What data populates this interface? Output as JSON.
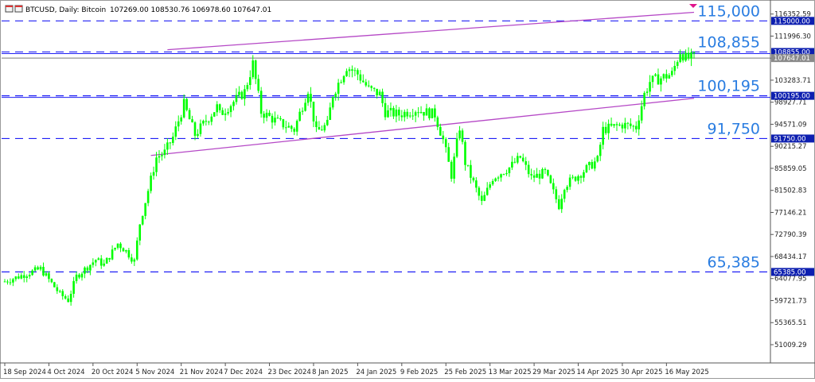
{
  "header": {
    "symbol": "BTCUSD, Daily:  Bitcoin",
    "ohlc": "107269.00  108530.76  106978.60  107647.01"
  },
  "chart_data": {
    "type": "candlestick",
    "symbol": "BTCUSD",
    "timeframe": "Daily",
    "ylim": [
      47400,
      118500
    ],
    "x_range": [
      "2024-09-18",
      "2025-05-26"
    ],
    "y_ticks": [
      "116352.59",
      "111996.30",
      "107640.01",
      "103283.71",
      "98927.71",
      "94571.09",
      "90215.27",
      "85859.05",
      "81502.83",
      "77146.21",
      "72790.39",
      "68434.17",
      "64077.95",
      "59721.73",
      "55365.51",
      "51009.29"
    ],
    "x_ticks": [
      {
        "date": "2024-09-18",
        "label": "18 Sep 2024"
      },
      {
        "date": "2024-10-04",
        "label": "4 Oct 2024"
      },
      {
        "date": "2024-10-20",
        "label": "20 Oct 2024"
      },
      {
        "date": "2024-11-05",
        "label": "5 Nov 2024"
      },
      {
        "date": "2024-11-21",
        "label": "21 Nov 2024"
      },
      {
        "date": "2024-12-07",
        "label": "7 Dec 2024"
      },
      {
        "date": "2024-12-23",
        "label": "23 Dec 2024"
      },
      {
        "date": "2025-01-08",
        "label": "8 Jan 2025"
      },
      {
        "date": "2025-01-24",
        "label": "24 Jan 2025"
      },
      {
        "date": "2025-02-09",
        "label": "9 Feb 2025"
      },
      {
        "date": "2025-02-25",
        "label": "25 Feb 2025"
      },
      {
        "date": "2025-03-13",
        "label": "13 Mar 2025"
      },
      {
        "date": "2025-03-29",
        "label": "29 Mar 2025"
      },
      {
        "date": "2025-04-14",
        "label": "14 Apr 2025"
      },
      {
        "date": "2025-04-30",
        "label": "30 Apr 2025"
      },
      {
        "date": "2025-05-16",
        "label": "16 May 2025"
      }
    ],
    "horizontal_levels": [
      {
        "value": 115000,
        "label": "115,000",
        "tag": "115000.00"
      },
      {
        "value": 108855,
        "label": "108,855",
        "tag": "108855.00"
      },
      {
        "value": 100195,
        "label": "100,195",
        "tag": "100195.00"
      },
      {
        "value": 91750,
        "label": "91,750",
        "tag": "91750.00"
      },
      {
        "value": 65385,
        "label": "65,385",
        "tag": "65385.00"
      }
    ],
    "current_price": {
      "value": 107647.01,
      "tag": "107647.01"
    },
    "trendlines": [
      {
        "from": {
          "date": "2024-11-16",
          "value": 109300
        },
        "to": {
          "date": "2025-05-26",
          "value": 116700
        }
      },
      {
        "from": {
          "date": "2024-11-10",
          "value": 88400
        },
        "to": {
          "date": "2025-05-26",
          "value": 99700
        }
      }
    ],
    "anchors": [
      [
        "2024-09-18",
        63500
      ],
      [
        "2024-10-01",
        66000
      ],
      [
        "2024-10-08",
        61000
      ],
      [
        "2024-10-11",
        59800
      ],
      [
        "2024-10-14",
        64500
      ],
      [
        "2024-10-21",
        67800
      ],
      [
        "2024-10-24",
        66800
      ],
      [
        "2024-10-29",
        71000
      ],
      [
        "2024-11-01",
        69500
      ],
      [
        "2024-11-04",
        67500
      ],
      [
        "2024-11-06",
        75000
      ],
      [
        "2024-11-12",
        88000
      ],
      [
        "2024-11-15",
        89000
      ],
      [
        "2024-11-18",
        92000
      ],
      [
        "2024-11-22",
        98500
      ],
      [
        "2024-11-26",
        92500
      ],
      [
        "2024-12-04",
        98000
      ],
      [
        "2024-12-05",
        96500
      ],
      [
        "2024-12-09",
        98500
      ],
      [
        "2024-12-14",
        101000
      ],
      [
        "2024-12-17",
        106500
      ],
      [
        "2024-12-20",
        97000
      ],
      [
        "2024-12-26",
        95000
      ],
      [
        "2025-01-01",
        93500
      ],
      [
        "2025-01-06",
        101500
      ],
      [
        "2025-01-09",
        93000
      ],
      [
        "2025-01-13",
        94500
      ],
      [
        "2025-01-15",
        100500
      ],
      [
        "2025-01-20",
        106000
      ],
      [
        "2025-01-24",
        104500
      ],
      [
        "2025-01-28",
        101500
      ],
      [
        "2025-02-01",
        100500
      ],
      [
        "2025-02-03",
        97000
      ],
      [
        "2025-02-08",
        96500
      ],
      [
        "2025-02-14",
        97500
      ],
      [
        "2025-02-21",
        96500
      ],
      [
        "2025-02-24",
        91500
      ],
      [
        "2025-02-27",
        84500
      ],
      [
        "2025-03-02",
        94000
      ],
      [
        "2025-03-04",
        87000
      ],
      [
        "2025-03-10",
        79000
      ],
      [
        "2025-03-14",
        84000
      ],
      [
        "2025-03-20",
        86000
      ],
      [
        "2025-03-24",
        88000
      ],
      [
        "2025-03-28",
        84000
      ],
      [
        "2025-04-02",
        85000
      ],
      [
        "2025-04-07",
        78500
      ],
      [
        "2025-04-09",
        82500
      ],
      [
        "2025-04-14",
        84500
      ],
      [
        "2025-04-21",
        87500
      ],
      [
        "2025-04-23",
        93500
      ],
      [
        "2025-04-30",
        94500
      ],
      [
        "2025-05-05",
        94000
      ],
      [
        "2025-05-08",
        100500
      ],
      [
        "2025-05-10",
        103000
      ],
      [
        "2025-05-14",
        103700
      ],
      [
        "2025-05-18",
        104500
      ],
      [
        "2025-05-21",
        109000
      ],
      [
        "2025-05-23",
        107600
      ],
      [
        "2025-05-26",
        107647
      ]
    ],
    "candle_color": "#00ff00",
    "level_line_color": "#1f1ff5",
    "level_label_color": "#2a7de1",
    "trendline_color": "#b548c6",
    "tag_background": "#0d1fb0"
  }
}
